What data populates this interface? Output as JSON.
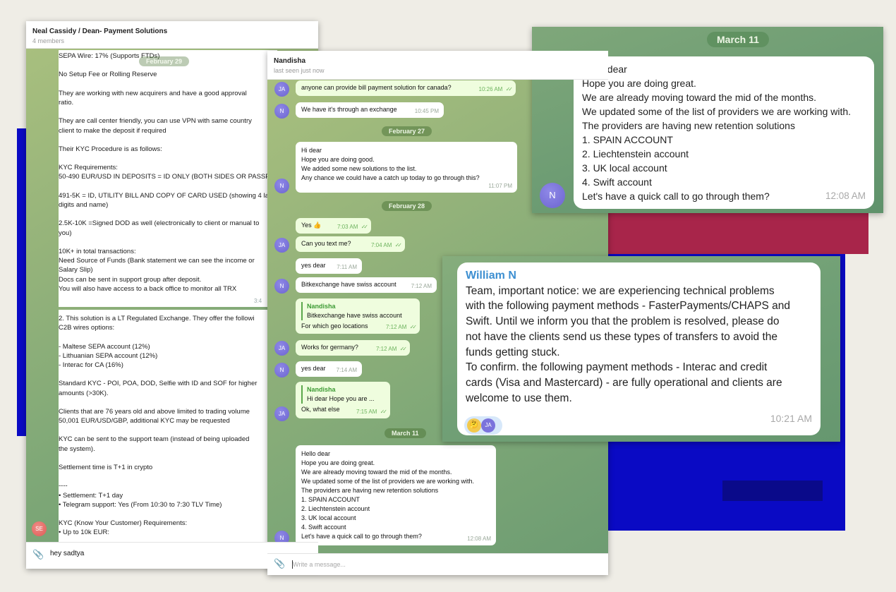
{
  "panel1": {
    "title": "Neal Cassidy / Dean- Payment Solutions",
    "subtitle": "4 members",
    "date_pill": "February 29",
    "message_top_lines": [
      "SEPA Wire: 17% (Supports FTDs)",
      "",
      "No Setup Fee or Rolling Reserve",
      "",
      "They are working with new acquirers and have a good approval",
      "ratio.",
      "",
      "They are call center friendly, you can use VPN with same country",
      "client to make the deposit if required",
      "",
      "Their KYC Procedure is as follows:",
      "",
      "KYC Requirements:",
      "50-490 EUR/USD IN DEPOSITS = ID ONLY (BOTH SIDES OR PASSPO",
      "",
      "491-5K = ID, UTILITY BILL AND COPY OF CARD USED (showing 4 las",
      "digits and name)",
      "",
      "2.5K-10K =Signed DOD as well (electronically to client or manual to",
      "you)",
      "",
      "10K+ in total transactions:",
      "Need Source of Funds (Bank statement we can see the income or",
      "Salary Slip)",
      "Docs can be sent in support group after deposit.",
      "You will also have access to a back office to monitor all TRX"
    ],
    "message_top_time": "3:4",
    "message_bottom_lines": [
      "2. This solution is a LT Regulated Exchange. They offer the followi",
      "C2B wires options:",
      "",
      "- Maltese SEPA account (12%)",
      "- Lithuanian SEPA account (12%)",
      "- Interac for CA (16%)",
      "",
      "Standard KYC - POI, POA, DOD, Selfie with ID and SOF for higher",
      "amounts (>30K).",
      "",
      "Clients that are 76 years old and above limited to trading volume",
      "50,001 EUR/USD/GBP, additional KYC may be requested",
      "",
      "KYC can be sent to the support team (instead of being uploaded",
      "the system).",
      "",
      "Settlement time is T+1 in crypto",
      "",
      "----",
      "• Settlement: T+1 day",
      "• Telegram support: Yes (From 10:30 to 7:30 TLV Time)",
      "",
      "KYC (Know Your Customer) Requirements:",
      "• Up to 10k EUR:"
    ],
    "avatar": "SE",
    "composer_text": "hey sadtya"
  },
  "panel2": {
    "title": "Nandisha",
    "subtitle": "last seen just now",
    "messages": [
      {
        "text": "anyone can provide bill payment solution for canada?",
        "time": "10:26 AM",
        "checks": "✓✓"
      },
      {
        "text": "We have it's through an exchange",
        "time": "10:45 PM"
      },
      {
        "date": "February 27"
      },
      {
        "lines": [
          "Hi dear",
          "Hope you are doing good.",
          "We added some new solutions to the list.",
          "Any chance we could have a catch up today to go through this?"
        ],
        "time": "11:07 PM"
      },
      {
        "date": "February 28"
      },
      {
        "text": "Yes 👍",
        "time": "7:03 AM",
        "checks": "✓✓"
      },
      {
        "text": "Can you text me?",
        "time": "7:04 AM",
        "checks": "✓✓"
      },
      {
        "text": "yes dear",
        "time": "7:11 AM"
      },
      {
        "text": "Bitkexchange have swiss account",
        "time": "7:12 AM"
      },
      {
        "quote_name": "Nandisha",
        "quote_text": "Bitkexchange have swiss account",
        "text": "For which geo locations",
        "time": "7:12 AM",
        "checks": "✓✓"
      },
      {
        "text": "Works for germany?",
        "time": "7:12 AM",
        "checks": "✓✓"
      },
      {
        "text": "yes dear",
        "time": "7:14 AM"
      },
      {
        "quote_name": "Nandisha",
        "quote_text": "Hi dear Hope you are ...",
        "text": "Ok, what else",
        "time": "7:15 AM",
        "checks": "✓✓"
      },
      {
        "date": "March 11"
      },
      {
        "lines": [
          "Hello dear",
          "Hope you are doing great.",
          "We are already moving toward the mid of the months.",
          "We updated some of the list of providers we are working with.",
          "The providers are having new retention solutions",
          "1. SPAIN ACCOUNT",
          "2. Liechtenstein account",
          "3. UK local account",
          "4. Swift account",
          "Let's have a quick call to go through them?"
        ],
        "time": "12:08 AM"
      }
    ],
    "avatar_ja": "JA",
    "avatar_n": "N",
    "composer_placeholder": "Write a message..."
  },
  "panel3": {
    "date_pill": "March 11",
    "lines": [
      "Hello dear",
      "Hope you are doing great.",
      "We are already moving toward the mid of the months.",
      "We updated some of the list of providers we are working with.",
      "The providers are having new retention solutions",
      "1. SPAIN ACCOUNT",
      "2. Liechtenstein account",
      "3. UK local account",
      "4. Swift account",
      "Let's have a quick call to go through them?"
    ],
    "time": "12:08 AM",
    "avatar": "N"
  },
  "panel4": {
    "sender": "William N",
    "lines": [
      "Team, important notice: we are experiencing technical problems",
      "with the following payment methods - FasterPayments/CHAPS and",
      "Swift. Until we inform you that the problem is resolved, please do",
      "not have the clients send us these types of transfers to avoid the",
      "funds getting stuck.",
      "To confirm. the following payment methods - Interac and credit",
      "cards (Visa and Mastercard) - are fully operational and clients are",
      "welcome to use them."
    ],
    "time": "10:21 AM",
    "reaction_emoji": "🤔",
    "reaction_avatar": "JA"
  },
  "colors": {
    "chat_green": "#8fb07a",
    "blue_bg": "#0a0ac4",
    "red_bg": "#a8254a",
    "outgoing_bubble": "#effdde",
    "sender_blue": "#3d8fd1"
  }
}
